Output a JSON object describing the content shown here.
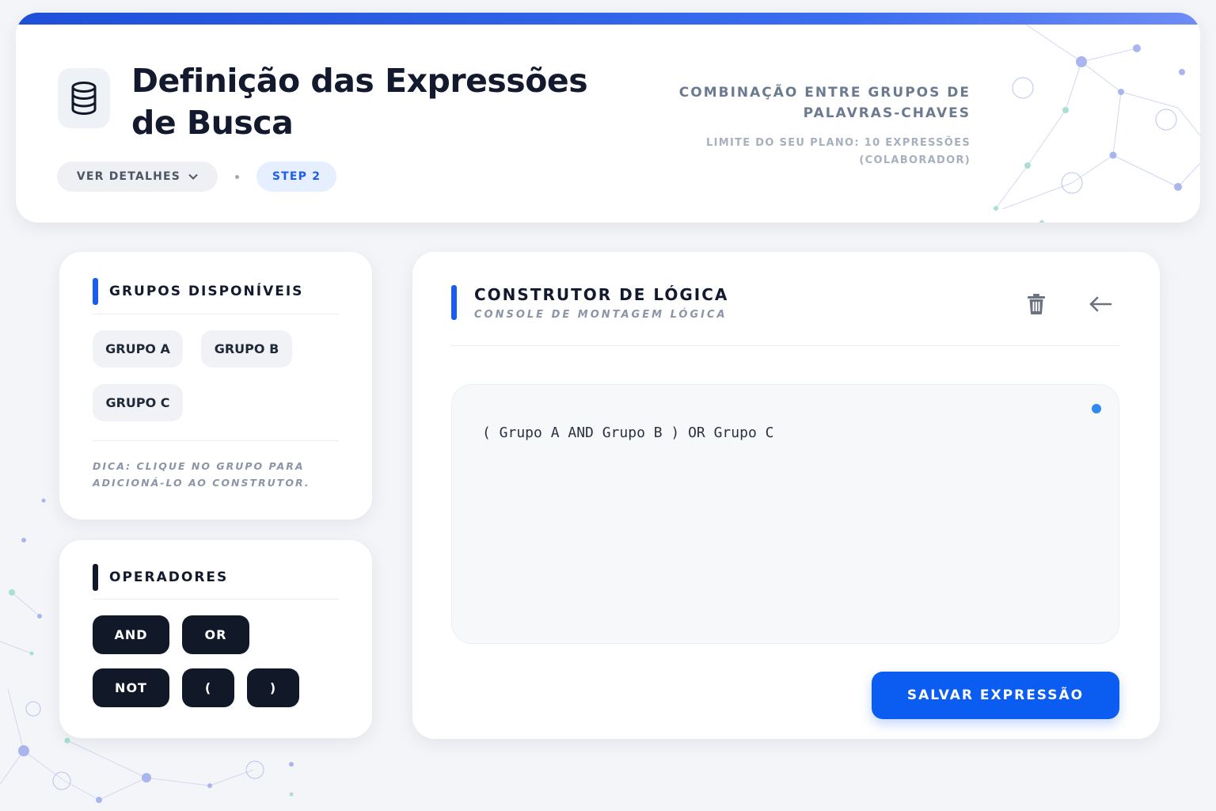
{
  "header": {
    "title": "Definição das Expressões de Busca",
    "details_label": "VER DETALHES",
    "step_label": "STEP 2",
    "subtitle": "COMBINAÇÃO ENTRE GRUPOS DE PALAVRAS-CHAVES",
    "plan_limit": "LIMITE DO SEU PLANO: 10 EXPRESSÕES (COLABORADOR)",
    "icons": {
      "main": "database-icon",
      "details": "chevron-down-icon"
    }
  },
  "groups": {
    "title": "GRUPOS DISPONÍVEIS",
    "items": [
      "GRUPO A",
      "GRUPO B",
      "GRUPO C"
    ],
    "tip": "DICA: CLIQUE NO GRUPO PARA ADICIONÁ-LO AO CONSTRUTOR."
  },
  "operators": {
    "title": "OPERADORES",
    "items": [
      "AND",
      "OR",
      "NOT",
      "(",
      ")"
    ]
  },
  "builder": {
    "title": "CONSTRUTOR DE LÓGICA",
    "subtitle": "CONSOLE DE MONTAGEM LÓGICA",
    "expression": "( Grupo A AND Grupo B ) OR Grupo C",
    "save_label": "SALVAR EXPRESSÃO",
    "icons": {
      "delete": "trash-icon",
      "back": "arrow-left-icon"
    }
  },
  "colors": {
    "accent": "#0b5cf0",
    "dark": "#111827",
    "status_dot": "#2f8af0"
  }
}
